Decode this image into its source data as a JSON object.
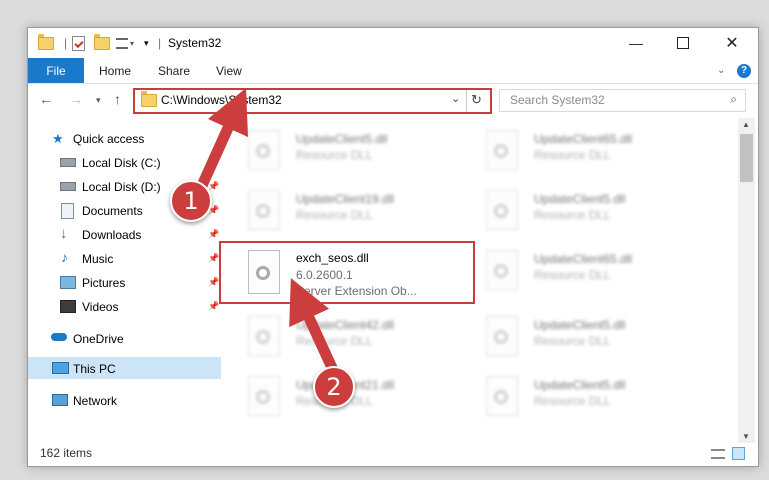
{
  "window": {
    "title": "System32"
  },
  "ribbon": {
    "tabs": [
      "File",
      "Home",
      "Share",
      "View"
    ]
  },
  "nav": {
    "address": "C:\\Windows\\System32",
    "search_placeholder": "Search System32"
  },
  "sidebar": {
    "items": [
      {
        "label": "Quick access",
        "icon": "star-icon"
      },
      {
        "label": "Local Disk (C:)",
        "icon": "drive-icon"
      },
      {
        "label": "Local Disk (D:)",
        "icon": "drive-icon"
      },
      {
        "label": "Documents",
        "icon": "documents-icon"
      },
      {
        "label": "Downloads",
        "icon": "download-icon"
      },
      {
        "label": "Music",
        "icon": "music-icon"
      },
      {
        "label": "Pictures",
        "icon": "pictures-icon"
      },
      {
        "label": "Videos",
        "icon": "videos-icon"
      },
      {
        "label": "OneDrive",
        "icon": "cloud-icon"
      },
      {
        "label": "This PC",
        "icon": "computer-icon"
      },
      {
        "label": "Network",
        "icon": "network-icon"
      }
    ]
  },
  "files": [
    {
      "name": "UpdateClient5.dll",
      "desc": "Resource DLL"
    },
    {
      "name": "UpdateClient65.dll",
      "desc": "Resource DLL"
    },
    {
      "name": "UpdateClient19.dll",
      "desc": "Resource DLL"
    },
    {
      "name": "UpdateClient5.dll",
      "desc": "Resource DLL"
    },
    {
      "name": "exch_seos.dll",
      "desc": "6.0.2600.1",
      "desc2": "Server Extension Ob..."
    },
    {
      "name": "UpdateClient65.dll",
      "desc": "Resource DLL"
    },
    {
      "name": "UpdateClient42.dll",
      "desc": "Resource DLL"
    },
    {
      "name": "UpdateClient5.dll",
      "desc": "Resource DLL"
    },
    {
      "name": "UpdateClient21.dll",
      "desc": "Resource DLL"
    },
    {
      "name": "UpdateClient5.dll",
      "desc": "Resource DLL"
    }
  ],
  "status": {
    "count": "162 items"
  },
  "annotations": {
    "step1": "1",
    "step2": "2"
  },
  "colors": {
    "accent": "#1979ca",
    "highlight": "#c53d3d"
  }
}
